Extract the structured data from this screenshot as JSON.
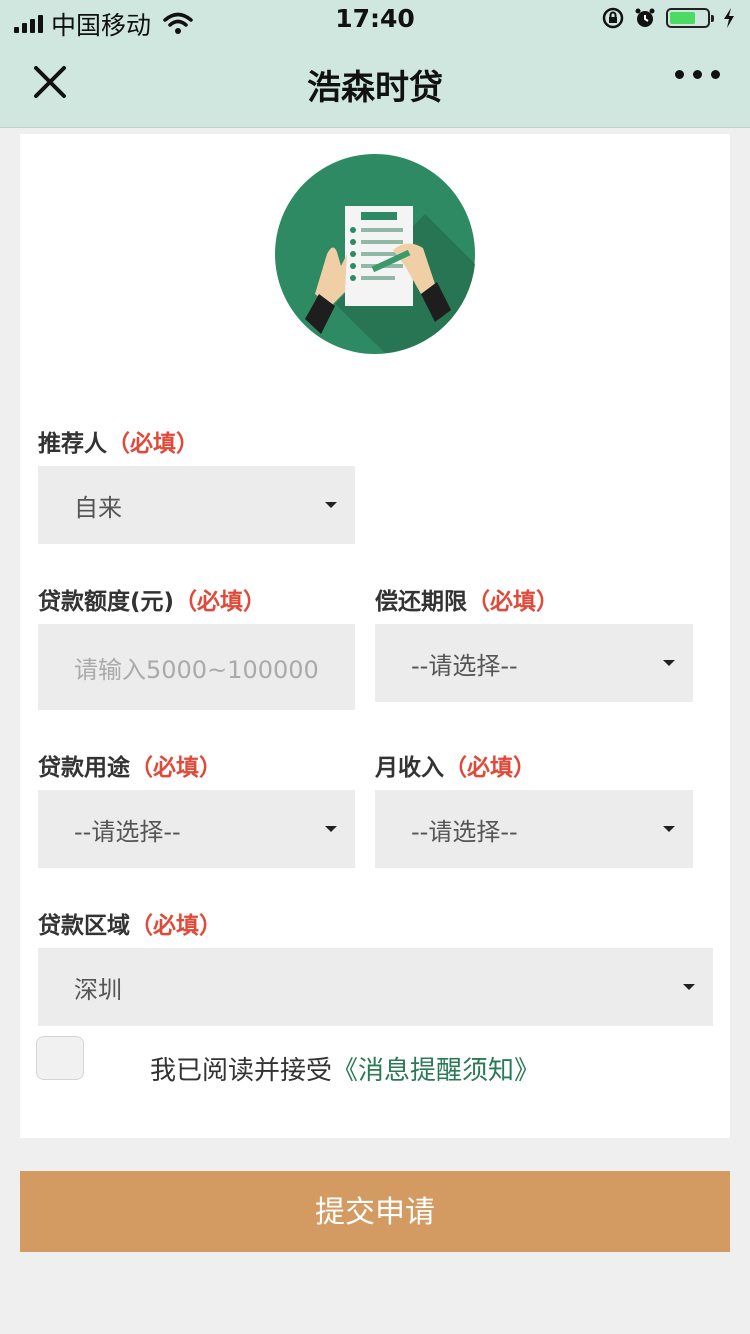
{
  "status_bar": {
    "carrier": "中国移动",
    "time": "17:40",
    "battery_level": 0.7
  },
  "nav": {
    "title": "浩森时贷"
  },
  "form": {
    "required_tag": "（必填）",
    "referrer": {
      "label": "推荐人",
      "value": "自来"
    },
    "loan_amount": {
      "label": "贷款额度(元)",
      "placeholder": "请输入5000~100000"
    },
    "repay_term": {
      "label": "偿还期限",
      "value": "--请选择--"
    },
    "loan_purpose": {
      "label": "贷款用途",
      "value": "--请选择--"
    },
    "monthly_income": {
      "label": "月收入",
      "value": "--请选择--"
    },
    "loan_region": {
      "label": "贷款区域",
      "value": "深圳"
    },
    "agreement": {
      "text": "我已阅读并接受",
      "link": "《消息提醒须知》",
      "checked": false
    }
  },
  "submit_label": "提交申请",
  "colors": {
    "header_bg": "#cfe7df",
    "required": "#e04a3a",
    "link": "#2b7a55",
    "submit_bg": "#d39b62",
    "logo_green": "#2e8a63"
  },
  "icons": [
    "signal-icon",
    "wifi-icon",
    "lock-rotation-icon",
    "alarm-icon",
    "battery-icon",
    "charging-icon",
    "close-icon",
    "more-icon",
    "application-form-icon",
    "dropdown-caret-icon"
  ]
}
